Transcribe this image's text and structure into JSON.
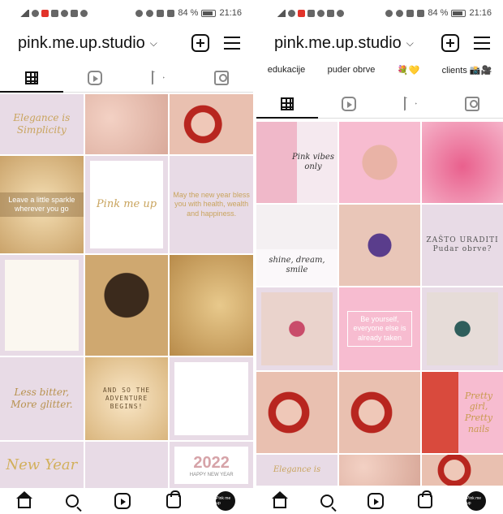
{
  "status": {
    "battery_left": "84 %",
    "time_left": "21:16",
    "battery_right": "84 %",
    "time_right": "21:16"
  },
  "profile": {
    "username": "pink.me.up.studio"
  },
  "highlights": [
    "edukacije",
    "puder obrve",
    "💐💛",
    "clients 📸🎥"
  ],
  "left_grid": [
    {
      "text": "Elegance is Simplicity"
    },
    {
      "text": ""
    },
    {
      "text": ""
    },
    {
      "text": "Leave a little sparkle wherever you go"
    },
    {
      "text": "Pink me up"
    },
    {
      "text": "May the new year bless you with health, wealth and happiness."
    },
    {
      "text": ""
    },
    {
      "text": ""
    },
    {
      "text": ""
    },
    {
      "text": "Less bitter, More glitter."
    },
    {
      "text": "AND SO THE ADVENTURE BEGINS!"
    },
    {
      "text": ""
    },
    {
      "text": "New Year"
    },
    {
      "text": ""
    },
    {
      "text": "2022"
    }
  ],
  "left_grid_subtext": {
    "new_year_label": "HAPPY NEW YEAR"
  },
  "right_grid": [
    {
      "text": "Pink vibes only"
    },
    {
      "text": ""
    },
    {
      "text": ""
    },
    {
      "text": "shine, dream, smile"
    },
    {
      "text": ""
    },
    {
      "text": "ZAŠTO URADITI Pudar obrve?"
    },
    {
      "text": ""
    },
    {
      "text": "Be yourself, everyone else is already taken"
    },
    {
      "text": ""
    },
    {
      "text": ""
    },
    {
      "text": ""
    },
    {
      "text": "Pretty girl, Pretty nails"
    },
    {
      "text": "Elegance is"
    },
    {
      "text": ""
    },
    {
      "text": ""
    }
  ],
  "avatar_text": "Pink me up"
}
